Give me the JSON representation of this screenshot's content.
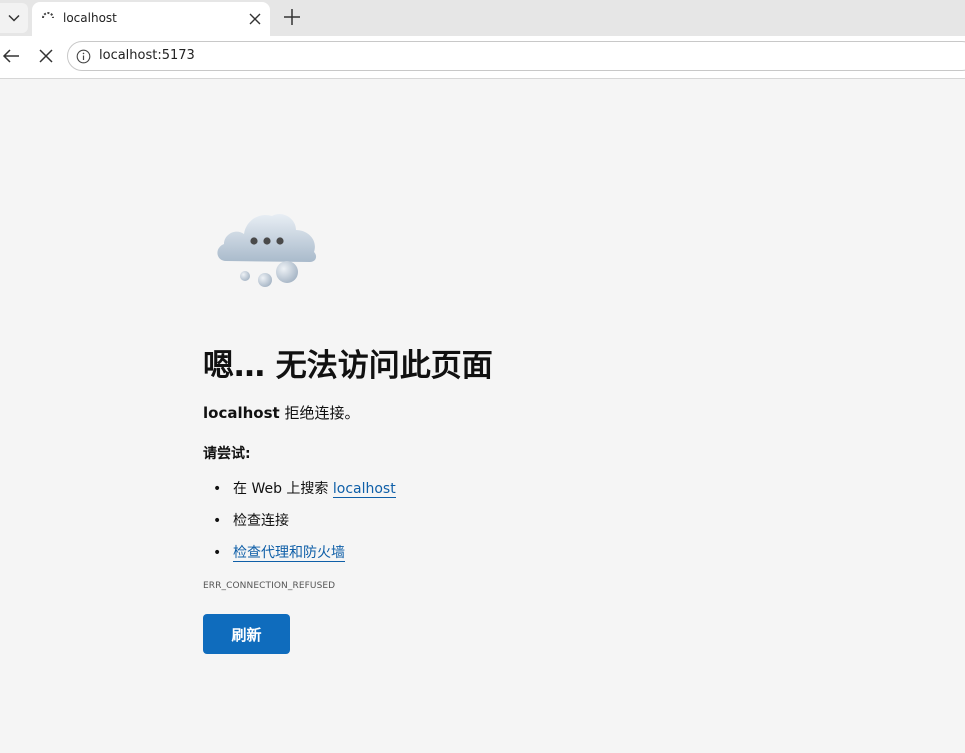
{
  "browser": {
    "tab": {
      "title": "localhost"
    },
    "address_bar": {
      "url": "localhost:5173"
    }
  },
  "error_page": {
    "headline": "嗯… 无法访问此页面",
    "host": "localhost",
    "reason": " 拒绝连接。",
    "try_label": "请尝试:",
    "suggestions": [
      {
        "prefix": "在 Web 上搜索 ",
        "link": "localhost"
      },
      {
        "text": "检查连接"
      },
      {
        "link": "检查代理和防火墙"
      }
    ],
    "error_code": "ERR_CONNECTION_REFUSED",
    "refresh_button": "刷新"
  },
  "colors": {
    "page_background": "#f5f5f5",
    "accent": "#0f6cbd",
    "link": "#0f5fa8"
  },
  "icons": [
    "chevron-down-icon",
    "loading-spinner-icon",
    "close-icon",
    "plus-icon",
    "back-arrow-icon",
    "stop-icon",
    "info-icon",
    "cloud-icon"
  ]
}
